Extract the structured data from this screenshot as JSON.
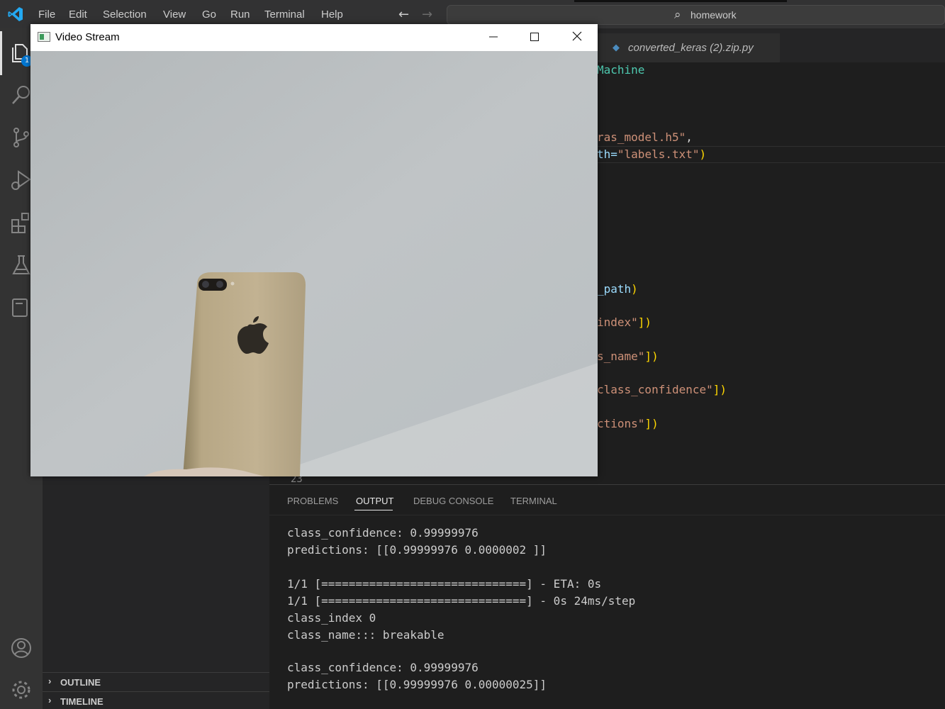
{
  "menu": [
    "File",
    "Edit",
    "Selection",
    "View",
    "Go",
    "Run",
    "Terminal",
    "Help"
  ],
  "search": {
    "text": "homework"
  },
  "activity": {
    "explorer_badge": "1"
  },
  "sidebar": {
    "outline_label": "OUTLINE",
    "timeline_label": "TIMELINE"
  },
  "editor": {
    "tab_label": "converted_keras (2).zip.py",
    "line_number": "23",
    "code": {
      "l1": "Machine",
      "l2a": "ras_model.h5\"",
      "l2b": ",",
      "l3a": "th=",
      "l3b": "\"labels.txt\"",
      "l3c": ")",
      "l4a": "_path",
      "l4b": ")",
      "l5a": "index\"",
      "l5b": "])",
      "l6a": "s_name\"",
      "l6b": "])",
      "l7a": "class_confidence\"",
      "l7b": "])",
      "l8a": "ctions\"",
      "l8b": "])"
    }
  },
  "panel": {
    "tabs": [
      "PROBLEMS",
      "OUTPUT",
      "DEBUG CONSOLE",
      "TERMINAL"
    ],
    "output": [
      "class_confidence: 0.99999976",
      "predictions: [[0.99999976 0.0000002 ]]",
      "",
      "1/1 [==============================] - ETA: 0s",
      "1/1 [==============================] - 0s 24ms/step",
      "class_index 0",
      "class_name::: breakable",
      "",
      "class_confidence: 0.99999976",
      "predictions: [[0.99999976 0.00000025]]"
    ]
  },
  "video_window": {
    "title": "Video Stream"
  },
  "colors": {
    "string": "#ce9178",
    "variable": "#9cdcfe",
    "keyword_green": "#4ec9b0",
    "bracket": "#ffd700",
    "plain": "#d4d4d4"
  }
}
